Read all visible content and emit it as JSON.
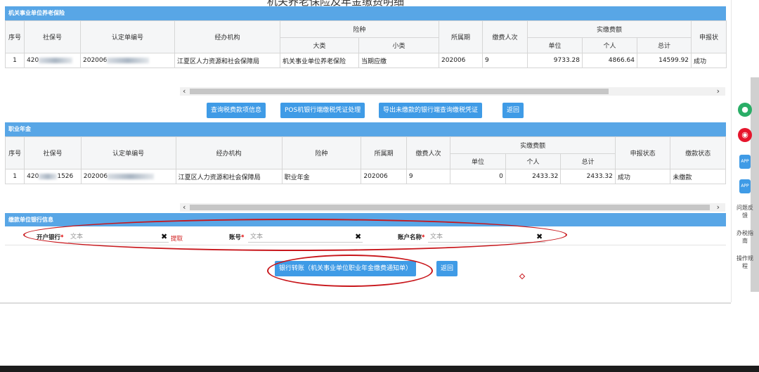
{
  "page": {
    "title": "机关养老保险及年金缴费明细"
  },
  "pension_panel": {
    "title": "机关事业单位养老保险",
    "headers": {
      "seq": "序号",
      "social_no": "社保号",
      "cert_no": "认定单编号",
      "agency": "经办机构",
      "insurance": "险种",
      "major": "大类",
      "minor": "小类",
      "period": "所属期",
      "payers": "缴费人次",
      "paid": "实缴费额",
      "unit": "单位",
      "personal": "个人",
      "total": "总计",
      "status": "申报状"
    },
    "row": {
      "seq": "1",
      "social_no": "420",
      "cert_no": "202006",
      "agency": "江夏区人力资源和社会保障局",
      "major": "机关事业单位养老保险",
      "minor": "当期应缴",
      "period": "202006",
      "payers": "9",
      "unit": "9733.28",
      "personal": "4866.64",
      "total": "14599.92",
      "status": "成功"
    }
  },
  "pension_buttons": {
    "query": "查询税费款项信息",
    "pos": "POS机银行端缴税凭证处理",
    "export": "导出未缴款的银行端查询缴税凭证",
    "back": "返回"
  },
  "annuity_panel": {
    "title": "职业年金",
    "headers": {
      "seq": "序号",
      "social_no": "社保号",
      "cert_no": "认定单编号",
      "agency": "经办机构",
      "insurance": "险种",
      "period": "所属期",
      "payers": "缴费人次",
      "paid": "实缴费额",
      "unit": "单位",
      "personal": "个人",
      "total": "总计",
      "report_status": "申报状态",
      "pay_status": "缴款状态"
    },
    "row": {
      "seq": "1",
      "social_no": "420",
      "social_no_tail": "1526",
      "cert_no": "202006",
      "agency": "江夏区人力资源和社会保障局",
      "insurance": "职业年金",
      "period": "202006",
      "payers": "9",
      "unit": "0",
      "personal": "2433.32",
      "total": "2433.32",
      "report_status": "成功",
      "pay_status": "未缴款"
    }
  },
  "bank_panel": {
    "title": "缴款单位银行信息",
    "bank_label": "开户银行",
    "account_label": "账号",
    "account_name_label": "账户名称",
    "required_mark": "*",
    "bank_placeholder": "文本",
    "account_placeholder": "文本",
    "account_name_placeholder": "文本",
    "fetch": "提取",
    "clear": "✖"
  },
  "bottom_buttons": {
    "transfer": "银行转账（机关事业单位职业年金缴费通知单）",
    "back": "返回"
  },
  "sidebar": [
    {
      "icon": "wechat-icon",
      "label": "",
      "color": "#2aae67"
    },
    {
      "icon": "weibo-icon",
      "label": "",
      "color": "#e6162d"
    },
    {
      "icon": "app-icon",
      "label": "",
      "color": "#3f9be6"
    },
    {
      "icon": "app-icon",
      "label": "",
      "color": "#3f9be6"
    },
    {
      "icon": "",
      "label": "问题反馈"
    },
    {
      "icon": "",
      "label": "办税指南"
    },
    {
      "icon": "",
      "label": "操作规程"
    }
  ],
  "colors": {
    "header": "#58a6e6",
    "button": "#3f9be6",
    "annotation": "#c8161b"
  }
}
